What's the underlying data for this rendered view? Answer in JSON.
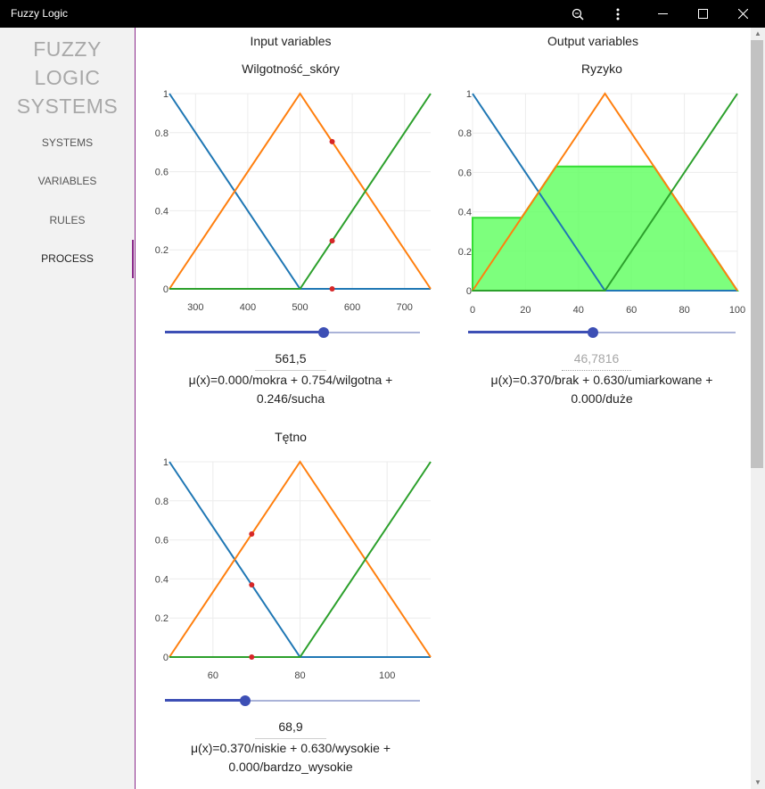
{
  "window": {
    "title": "Fuzzy Logic"
  },
  "titlebar_icons": [
    "zoom-icon",
    "more-vertical-icon",
    "minimize-icon",
    "maximize-icon",
    "close-icon"
  ],
  "sidebar": {
    "logo_lines": [
      "FUZZY",
      "LOGIC",
      "SYSTEMS"
    ],
    "items": [
      {
        "label": "SYSTEMS",
        "active": false
      },
      {
        "label": "VARIABLES",
        "active": false
      },
      {
        "label": "RULES",
        "active": false
      },
      {
        "label": "PROCESS",
        "active": true
      }
    ]
  },
  "sections": {
    "input_title": "Input variables",
    "output_title": "Output variables"
  },
  "colors": {
    "blue": "#1f77b4",
    "orange": "#ff7f0e",
    "green": "#2ca02c",
    "marker": "#d62728",
    "area_fill": "#66ff66",
    "area_stroke": "#33dd33",
    "accent": "#8b2a8b",
    "slider": "#3d4fb5"
  },
  "panels": [
    {
      "id": "wilgotnosc",
      "title": "Wilgotność_skóry",
      "value": "561,5",
      "value_disabled": false,
      "formula_lines": [
        "μ(x)=0.000/mokra + 0.754/wilgotna +",
        "0.246/sucha"
      ],
      "slider_fraction": 0.623,
      "chart_data": {
        "type": "line",
        "xlim": [
          250,
          750
        ],
        "ylim": [
          0,
          1
        ],
        "x_ticks": [
          "300",
          "400",
          "500",
          "600",
          "700"
        ],
        "x_tick_values": [
          300,
          400,
          500,
          600,
          700
        ],
        "y_ticks": [
          "0",
          "0.2",
          "0.4",
          "0.6",
          "0.8",
          "1"
        ],
        "y_tick_values": [
          0,
          0.2,
          0.4,
          0.6,
          0.8,
          1
        ],
        "series": [
          {
            "color": "blue",
            "points": [
              [
                250,
                1
              ],
              [
                500,
                0
              ],
              [
                750,
                0
              ]
            ]
          },
          {
            "color": "orange",
            "points": [
              [
                250,
                0
              ],
              [
                500,
                1
              ],
              [
                750,
                0
              ]
            ]
          },
          {
            "color": "green",
            "points": [
              [
                250,
                0
              ],
              [
                500,
                0
              ],
              [
                750,
                1
              ]
            ]
          }
        ],
        "markers": [
          [
            561.5,
            0.0
          ],
          [
            561.5,
            0.754
          ],
          [
            561.5,
            0.246
          ]
        ],
        "area": null
      }
    },
    {
      "id": "ryzyko",
      "title": "Ryzyko",
      "value": "46,7816",
      "value_disabled": true,
      "formula_lines": [
        "μ(x)=0.370/brak + 0.630/umiarkowane +",
        "0.000/duże"
      ],
      "slider_fraction": 0.468,
      "chart_data": {
        "type": "area",
        "xlim": [
          0,
          100
        ],
        "ylim": [
          0,
          1
        ],
        "x_ticks": [
          "0",
          "20",
          "40",
          "60",
          "80",
          "100"
        ],
        "x_tick_values": [
          0,
          20,
          40,
          60,
          80,
          100
        ],
        "y_ticks": [
          "0",
          "0.2",
          "0.4",
          "0.6",
          "0.8",
          "1"
        ],
        "y_tick_values": [
          0,
          0.2,
          0.4,
          0.6,
          0.8,
          1
        ],
        "series": [
          {
            "color": "blue",
            "points": [
              [
                0,
                1
              ],
              [
                50,
                0
              ],
              [
                100,
                0
              ]
            ]
          },
          {
            "color": "orange",
            "points": [
              [
                0,
                0
              ],
              [
                50,
                1
              ],
              [
                100,
                0
              ]
            ]
          },
          {
            "color": "green",
            "points": [
              [
                0,
                0
              ],
              [
                50,
                0
              ],
              [
                100,
                1
              ]
            ]
          }
        ],
        "markers": [],
        "area": [
          [
            0,
            0
          ],
          [
            0,
            0.37
          ],
          [
            18.5,
            0.37
          ],
          [
            31.5,
            0.63
          ],
          [
            68.5,
            0.63
          ],
          [
            100,
            0
          ],
          [
            0,
            0
          ]
        ]
      }
    },
    {
      "id": "tetno",
      "title": "Tętno",
      "value": "68,9",
      "value_disabled": false,
      "formula_lines": [
        "μ(x)=0.370/niskie + 0.630/wysokie +",
        "0.000/bardzo_wysokie"
      ],
      "slider_fraction": 0.315,
      "chart_data": {
        "type": "line",
        "xlim": [
          50,
          110
        ],
        "ylim": [
          0,
          1
        ],
        "x_ticks": [
          "60",
          "80",
          "100"
        ],
        "x_tick_values": [
          60,
          80,
          100
        ],
        "y_ticks": [
          "0",
          "0.2",
          "0.4",
          "0.6",
          "0.8",
          "1"
        ],
        "y_tick_values": [
          0,
          0.2,
          0.4,
          0.6,
          0.8,
          1
        ],
        "series": [
          {
            "color": "blue",
            "points": [
              [
                50,
                1
              ],
              [
                80,
                0
              ],
              [
                110,
                0
              ]
            ]
          },
          {
            "color": "orange",
            "points": [
              [
                50,
                0
              ],
              [
                80,
                1
              ],
              [
                110,
                0
              ]
            ]
          },
          {
            "color": "green",
            "points": [
              [
                50,
                0
              ],
              [
                80,
                0
              ],
              [
                110,
                1
              ]
            ]
          }
        ],
        "markers": [
          [
            68.9,
            0.63
          ],
          [
            68.9,
            0.37
          ],
          [
            68.9,
            0.0
          ]
        ],
        "area": null
      }
    }
  ]
}
